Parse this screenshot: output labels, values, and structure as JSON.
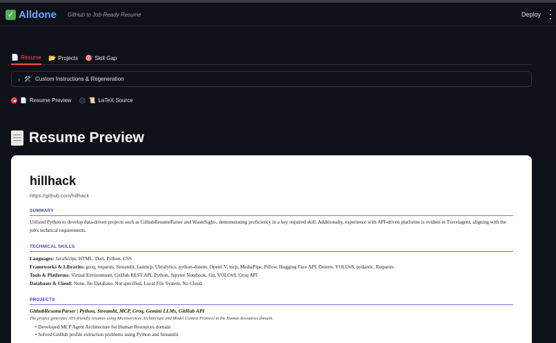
{
  "app": {
    "brand": "Alldone",
    "tagline": "GitHub to Job-Ready Resume",
    "deploy_label": "Deploy"
  },
  "tabs": [
    {
      "icon": "📄",
      "label": "Resume",
      "active": true
    },
    {
      "icon": "📂",
      "label": "Projects",
      "active": false
    },
    {
      "icon": "🎯",
      "label": "Skill Gap",
      "active": false
    }
  ],
  "expander": {
    "icon": "🛠️",
    "label": "Custom Instructions & Regeneration"
  },
  "view_options": [
    {
      "icon": "📄",
      "label": "Resume Preview",
      "selected": true
    },
    {
      "icon": "📜",
      "label": "LaTeX Source",
      "selected": false
    }
  ],
  "section": {
    "title": "Resume Preview"
  },
  "resume": {
    "name": "hillhack",
    "link": "https://github.com/hillhack",
    "summary_heading": "SUMMARY",
    "summary": "Utilized Python to develop data-driven projects such as GithubResumeParser and WasteSight-, demonstrating proficiency in a key required skill. Additionally, experience with API-driven platforms is evident in Travelagent, aligning with the job's technical requirements.",
    "skills_heading": "TECHNICAL SKILLS",
    "skills": [
      {
        "label": "Languages:",
        "value": "JavaScript, HTML, Dart, Python, CSS"
      },
      {
        "label": "Frameworks & Libraries:",
        "value": "groq, requests, Streamlit, fastmcp, Ultralytics, python-dotenv, OpenCV, mcp, MediaPipe, Pillow, Hugging Face API, Dotenv, YOLOv8, pydantic, Requests"
      },
      {
        "label": "Tools & Platforms:",
        "value": "Virtual Environment, GitHub REST API, Python, Jupyter Notebook, Git, YOLOv8, Groq API"
      },
      {
        "label": "Databases & Cloud:",
        "value": "None, No Database, Not specified, Local File System, No Cloud"
      }
    ],
    "projects_heading": "PROJECTS",
    "projects": [
      {
        "title": "GithubResumeParser | Python, Streamlit, MCP, Groq, Gemini LLMs, GitHub API",
        "description": "The project generates ATS-friendly resumes using Microservices Architecture and Model Context Protocol in the Human Resources domain.",
        "bullets": [
          "Developed MCP Agent Architecture for Human Resources domain",
          "Solved GitHub profile extraction problems using Python and Streamlit"
        ]
      }
    ]
  }
}
